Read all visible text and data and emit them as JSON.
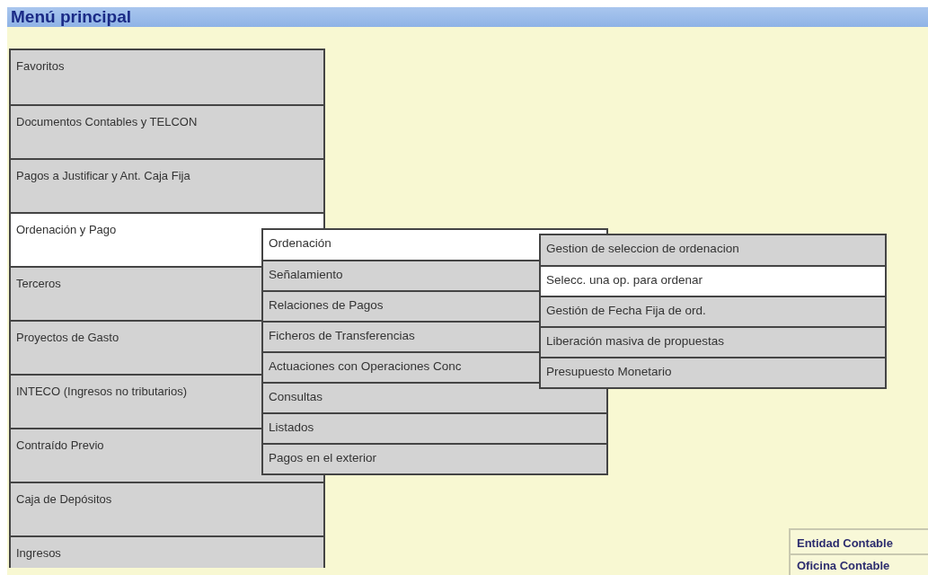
{
  "header": {
    "title": "Menú principal"
  },
  "main_menu": {
    "items": [
      {
        "label": "Favoritos",
        "selected": false
      },
      {
        "label": "Documentos Contables y TELCON",
        "selected": false
      },
      {
        "label": "Pagos a Justificar y Ant. Caja Fija",
        "selected": false
      },
      {
        "label": "Ordenación y Pago",
        "selected": true,
        "children": [
          {
            "label": "Ordenación",
            "selected": true,
            "children": [
              {
                "label": "Gestion de seleccion de ordenacion",
                "selected": false
              },
              {
                "label": "Selecc. una op. para ordenar",
                "selected": true
              },
              {
                "label": "Gestión de Fecha Fija de ord.",
                "selected": false
              },
              {
                "label": "Liberación masiva de propuestas",
                "selected": false
              },
              {
                "label": "Presupuesto Monetario",
                "selected": false
              }
            ]
          },
          {
            "label": "Señalamiento",
            "selected": false
          },
          {
            "label": "Relaciones de Pagos",
            "selected": false
          },
          {
            "label": "Ficheros de Transferencias",
            "selected": false
          },
          {
            "label": "Actuaciones con Operaciones Conc",
            "selected": false
          },
          {
            "label": "Consultas",
            "selected": false
          },
          {
            "label": "Listados",
            "selected": false
          },
          {
            "label": "Pagos en el exterior",
            "selected": false
          }
        ]
      },
      {
        "label": "Terceros",
        "selected": false
      },
      {
        "label": "Proyectos de Gasto",
        "selected": false
      },
      {
        "label": "INTECO (Ingresos no tributarios)",
        "selected": false
      },
      {
        "label": "Contraído Previo",
        "selected": false
      },
      {
        "label": "Caja de Depósitos",
        "selected": false
      },
      {
        "label": "Ingresos",
        "selected": false
      }
    ]
  },
  "info_panel": {
    "labels": [
      "Entidad Contable",
      "Oficina Contable"
    ]
  }
}
